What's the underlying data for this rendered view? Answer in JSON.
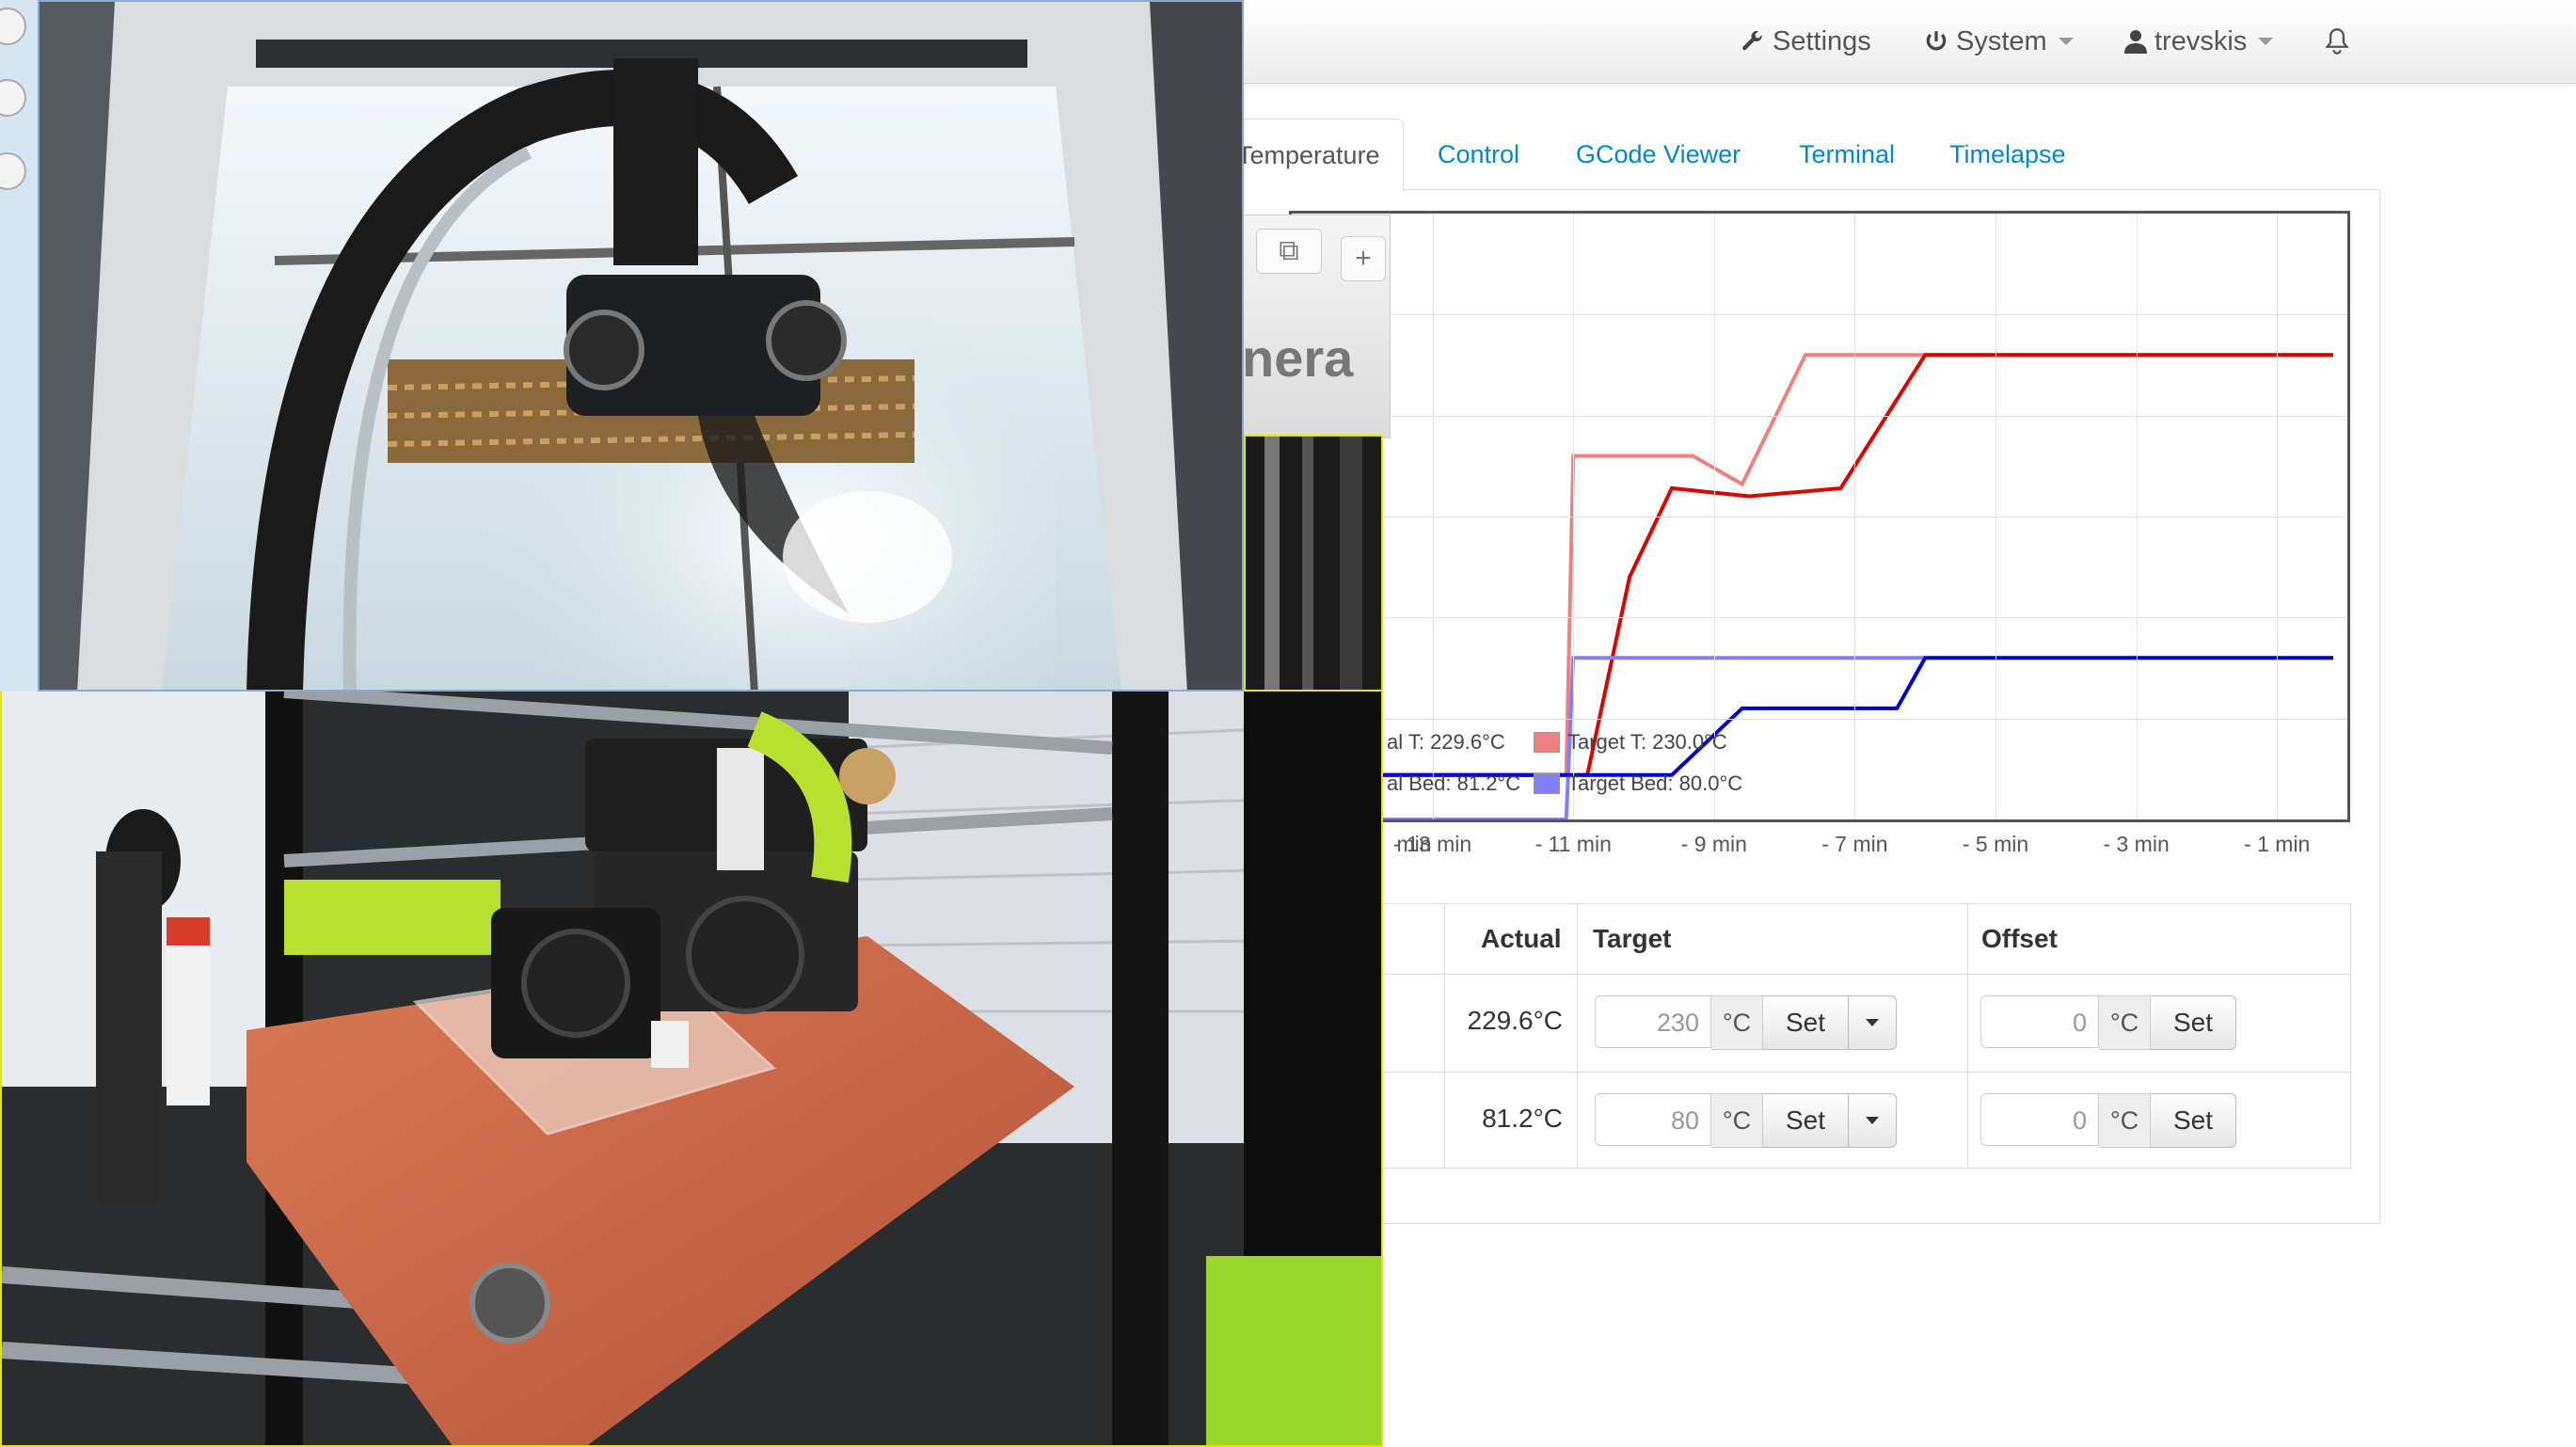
{
  "navbar": {
    "settings_label": "Settings",
    "system_label": "System",
    "user_label": "trevskis"
  },
  "tabs": [
    "Temperature",
    "Control",
    "GCode Viewer",
    "Terminal",
    "Timelapse"
  ],
  "active_tab": "Temperature",
  "camera_panel": {
    "title_fragment": "nera"
  },
  "chart_data": {
    "type": "line",
    "x_tick_labels": [
      "min",
      "- 13 min",
      "- 11 min",
      "- 9 min",
      "- 7 min",
      "- 5 min",
      "- 3 min",
      "- 1 min"
    ],
    "xlim": [
      -15,
      0
    ],
    "ylim": [
      0,
      300
    ],
    "grid": true,
    "legend_placement": "bottom-left",
    "legend": {
      "actual_tool": "al T: 229.6°C",
      "target_tool": "Target T: 230.0°C",
      "actual_bed": "al Bed: 81.2°C",
      "target_bed": "Target Bed: 80.0°C"
    },
    "series": [
      {
        "name": "Target T",
        "color": "#f08080",
        "x": [
          -15,
          -11.1,
          -11,
          -9.3,
          -8.6,
          -7.7,
          -0.2
        ],
        "y": [
          22,
          22,
          180,
          180,
          166,
          230,
          230
        ]
      },
      {
        "name": "Actual T",
        "color": "#e00000",
        "x": [
          -15,
          -10.8,
          -10.2,
          -9.6,
          -8.5,
          -7.2,
          -6.0,
          -0.2
        ],
        "y": [
          22,
          22,
          120,
          164,
          160,
          164,
          230,
          230
        ]
      },
      {
        "name": "Target Bed",
        "color": "#8080ff",
        "x": [
          -15,
          -11.1,
          -11,
          -6.0,
          -0.2
        ],
        "y": [
          0,
          0,
          80,
          80,
          80
        ]
      },
      {
        "name": "Actual Bed",
        "color": "#0000d0",
        "x": [
          -15,
          -9.6,
          -8.6,
          -6.4,
          -6.0,
          -0.2
        ],
        "y": [
          22,
          22,
          55,
          55,
          80,
          80
        ]
      }
    ]
  },
  "temp_table": {
    "headers": {
      "actual": "Actual",
      "target": "Target",
      "offset": "Offset"
    },
    "unit": "°C",
    "set_label": "Set",
    "rows": [
      {
        "actual": "229.6°C",
        "target_value": "230",
        "offset_value": "0"
      },
      {
        "actual": "81.2°C",
        "target_value": "80",
        "offset_value": "0"
      }
    ]
  },
  "colors": {
    "link": "#0088cc",
    "tool_target": "#f08080",
    "tool_actual": "#e00000",
    "bed_target": "#8080ff",
    "bed_actual": "#0000d0",
    "camera_border": "#e5e500"
  },
  "icons": {
    "settings": "wrench-icon",
    "system": "power-icon",
    "user": "user-icon",
    "notifications": "bell-icon"
  }
}
